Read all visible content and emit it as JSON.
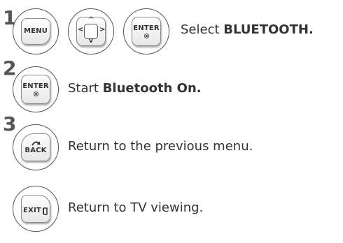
{
  "steps": [
    {
      "number": "1",
      "text": "Select ",
      "bold": "BLUETOOTH."
    },
    {
      "number": "2",
      "text": "Start ",
      "bold": "Bluetooth On."
    },
    {
      "number": "3",
      "text": "Return to the previous menu.",
      "bold": ""
    },
    {
      "number": "",
      "text": "Return to TV viewing.",
      "bold": ""
    }
  ],
  "keys": {
    "menu": "MENU",
    "enter": "ENTER",
    "back": "BACK",
    "exit": "EXIT"
  },
  "nav_arrows": {
    "up": "^",
    "down": "v",
    "left": "<",
    "right": ">"
  }
}
